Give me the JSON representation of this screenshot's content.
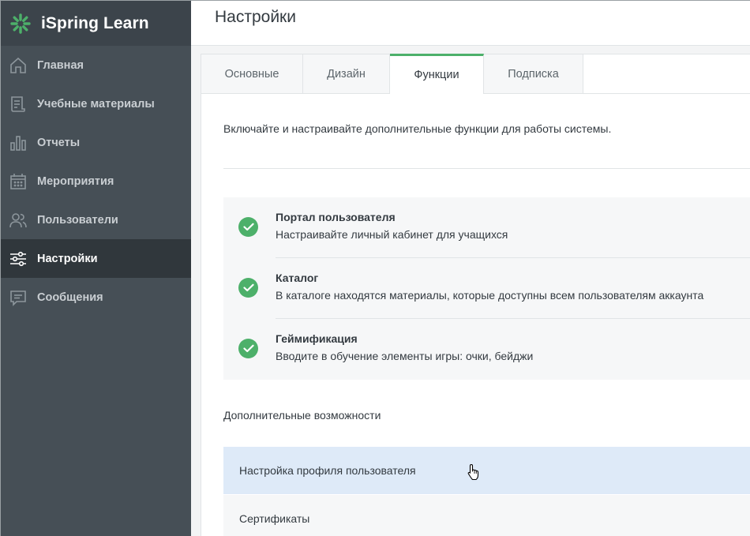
{
  "app": {
    "name": "iSpring Learn",
    "brand_color": "#4db06a"
  },
  "sidebar": {
    "items": [
      {
        "label": "Главная",
        "icon": "home-icon",
        "active": false
      },
      {
        "label": "Учебные материалы",
        "icon": "materials-icon",
        "active": false
      },
      {
        "label": "Отчеты",
        "icon": "reports-icon",
        "active": false
      },
      {
        "label": "Мероприятия",
        "icon": "calendar-icon",
        "active": false
      },
      {
        "label": "Пользователи",
        "icon": "users-icon",
        "active": false
      },
      {
        "label": "Настройки",
        "icon": "settings-sliders-icon",
        "active": true
      },
      {
        "label": "Сообщения",
        "icon": "messages-icon",
        "active": false
      }
    ]
  },
  "header": {
    "title": "Настройки"
  },
  "tabs": [
    {
      "label": "Основные",
      "active": false
    },
    {
      "label": "Дизайн",
      "active": false
    },
    {
      "label": "Функции",
      "active": true
    },
    {
      "label": "Подписка",
      "active": false
    }
  ],
  "content": {
    "intro": "Включайте и настраивайте дополнительные функции для работы системы.",
    "features": [
      {
        "title": "Портал пользователя",
        "description": "Настраивайте личный кабинет для учащихся",
        "enabled": true
      },
      {
        "title": "Каталог",
        "description": "В каталоге находятся материалы, которые доступны всем пользователям аккаунта",
        "enabled": true
      },
      {
        "title": "Геймификация",
        "description": "Вводите в обучение элементы игры: очки, бейджи",
        "enabled": true
      }
    ],
    "extra_title": "Дополнительные возможности",
    "extra_items": [
      {
        "label": "Настройка профиля пользователя",
        "hovered": true
      },
      {
        "label": "Сертификаты",
        "hovered": false
      }
    ]
  }
}
